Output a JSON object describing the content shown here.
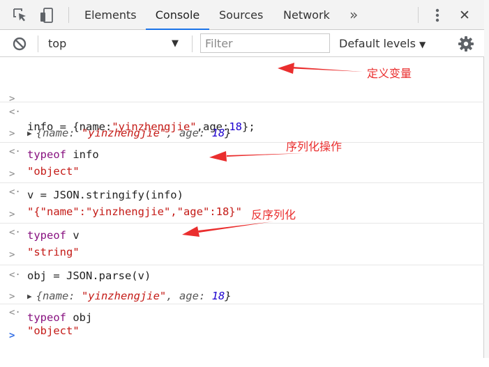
{
  "tabs": {
    "inspect_icon": "cursor-arrow-icon",
    "device_icon": "device-toggle-icon",
    "items": [
      {
        "label": "Elements"
      },
      {
        "label": "Console"
      },
      {
        "label": "Sources"
      },
      {
        "label": "Network"
      }
    ],
    "active": "Console",
    "more": "»",
    "menu_icon": "vertical-dots-icon",
    "close": "✕"
  },
  "toolbar": {
    "clear_icon": "no-entry-icon",
    "context": "top",
    "context_caret": "▼",
    "filter_placeholder": "Filter",
    "levels": "Default levels",
    "levels_caret": "▼",
    "settings_icon": "gear-icon"
  },
  "console": {
    "input_prompt": ">",
    "output_prompt": "<·",
    "expand_icon": "▶",
    "rows": [
      {
        "type": "input",
        "parts": [
          "info = {name:",
          "\"yinzhengjie\"",
          ",age:",
          "18",
          "};"
        ]
      },
      {
        "type": "output",
        "parts": [
          "{name: ",
          "\"yinzhengjie\"",
          ", age: ",
          "18",
          "}"
        ]
      },
      {
        "type": "input",
        "parts": [
          "typeof",
          " info"
        ]
      },
      {
        "type": "output",
        "parts": [
          "\"object\""
        ]
      },
      {
        "type": "input",
        "parts": [
          "v = JSON.stringify(info)"
        ]
      },
      {
        "type": "output",
        "parts": [
          "\"{\"name\":\"yinzhengjie\",\"age\":18}\""
        ]
      },
      {
        "type": "input",
        "parts": [
          "typeof",
          " v"
        ]
      },
      {
        "type": "output",
        "parts": [
          "\"string\""
        ]
      },
      {
        "type": "input",
        "parts": [
          "obj = JSON.parse(v)"
        ]
      },
      {
        "type": "output",
        "parts": [
          "{name: ",
          "\"yinzhengjie\"",
          ", age: ",
          "18",
          "}"
        ]
      },
      {
        "type": "input",
        "parts": [
          "typeof",
          " obj"
        ]
      },
      {
        "type": "output",
        "parts": [
          "\"object\""
        ]
      }
    ]
  },
  "annotations": {
    "define": "定义变量",
    "serialize": "序列化操作",
    "deserialize": "反序列化",
    "color": "#ea2e2e"
  }
}
